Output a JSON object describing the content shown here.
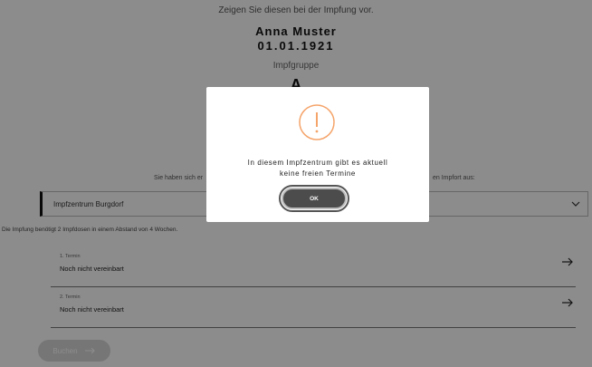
{
  "background_page": {
    "intro": "Zeigen Sie diesen bei der Impfung vor.",
    "person": {
      "name": "Anna Muster",
      "dob": "01.01.1921"
    },
    "vaccination_group": {
      "label": "Impfgruppe",
      "value": "A"
    },
    "choose_text_left": "Sie haben sich er",
    "choose_text_right": "en Impfort aus:",
    "center_select": {
      "selected": "Impfzentrum Burgdorf",
      "icon": "chevron-down-icon"
    },
    "dose_note": "Die Impfung benötigt 2 Impfdosen in einem Abstand von 4 Wochen.",
    "appointments": [
      {
        "label": "1. Termin",
        "value": "Noch nicht vereinbart",
        "icon": "arrow-right-icon"
      },
      {
        "label": "2. Termin",
        "value": "Noch nicht vereinbart",
        "icon": "arrow-right-icon"
      }
    ],
    "book_button": {
      "label": "Buchen",
      "state": "disabled",
      "icon": "arrow-right-icon"
    }
  },
  "modal": {
    "icon": "warning-icon",
    "icon_color": "#f5a46a",
    "message_line1": "In diesem Impfzentrum gibt es aktuell",
    "message_line2": "keine freien Termine",
    "ok_label": "OK"
  },
  "colors": {
    "overlay": "rgba(0,0,0,0.45)",
    "button_dark": "#4c4c4c",
    "accent_warning": "#f5a46a"
  }
}
